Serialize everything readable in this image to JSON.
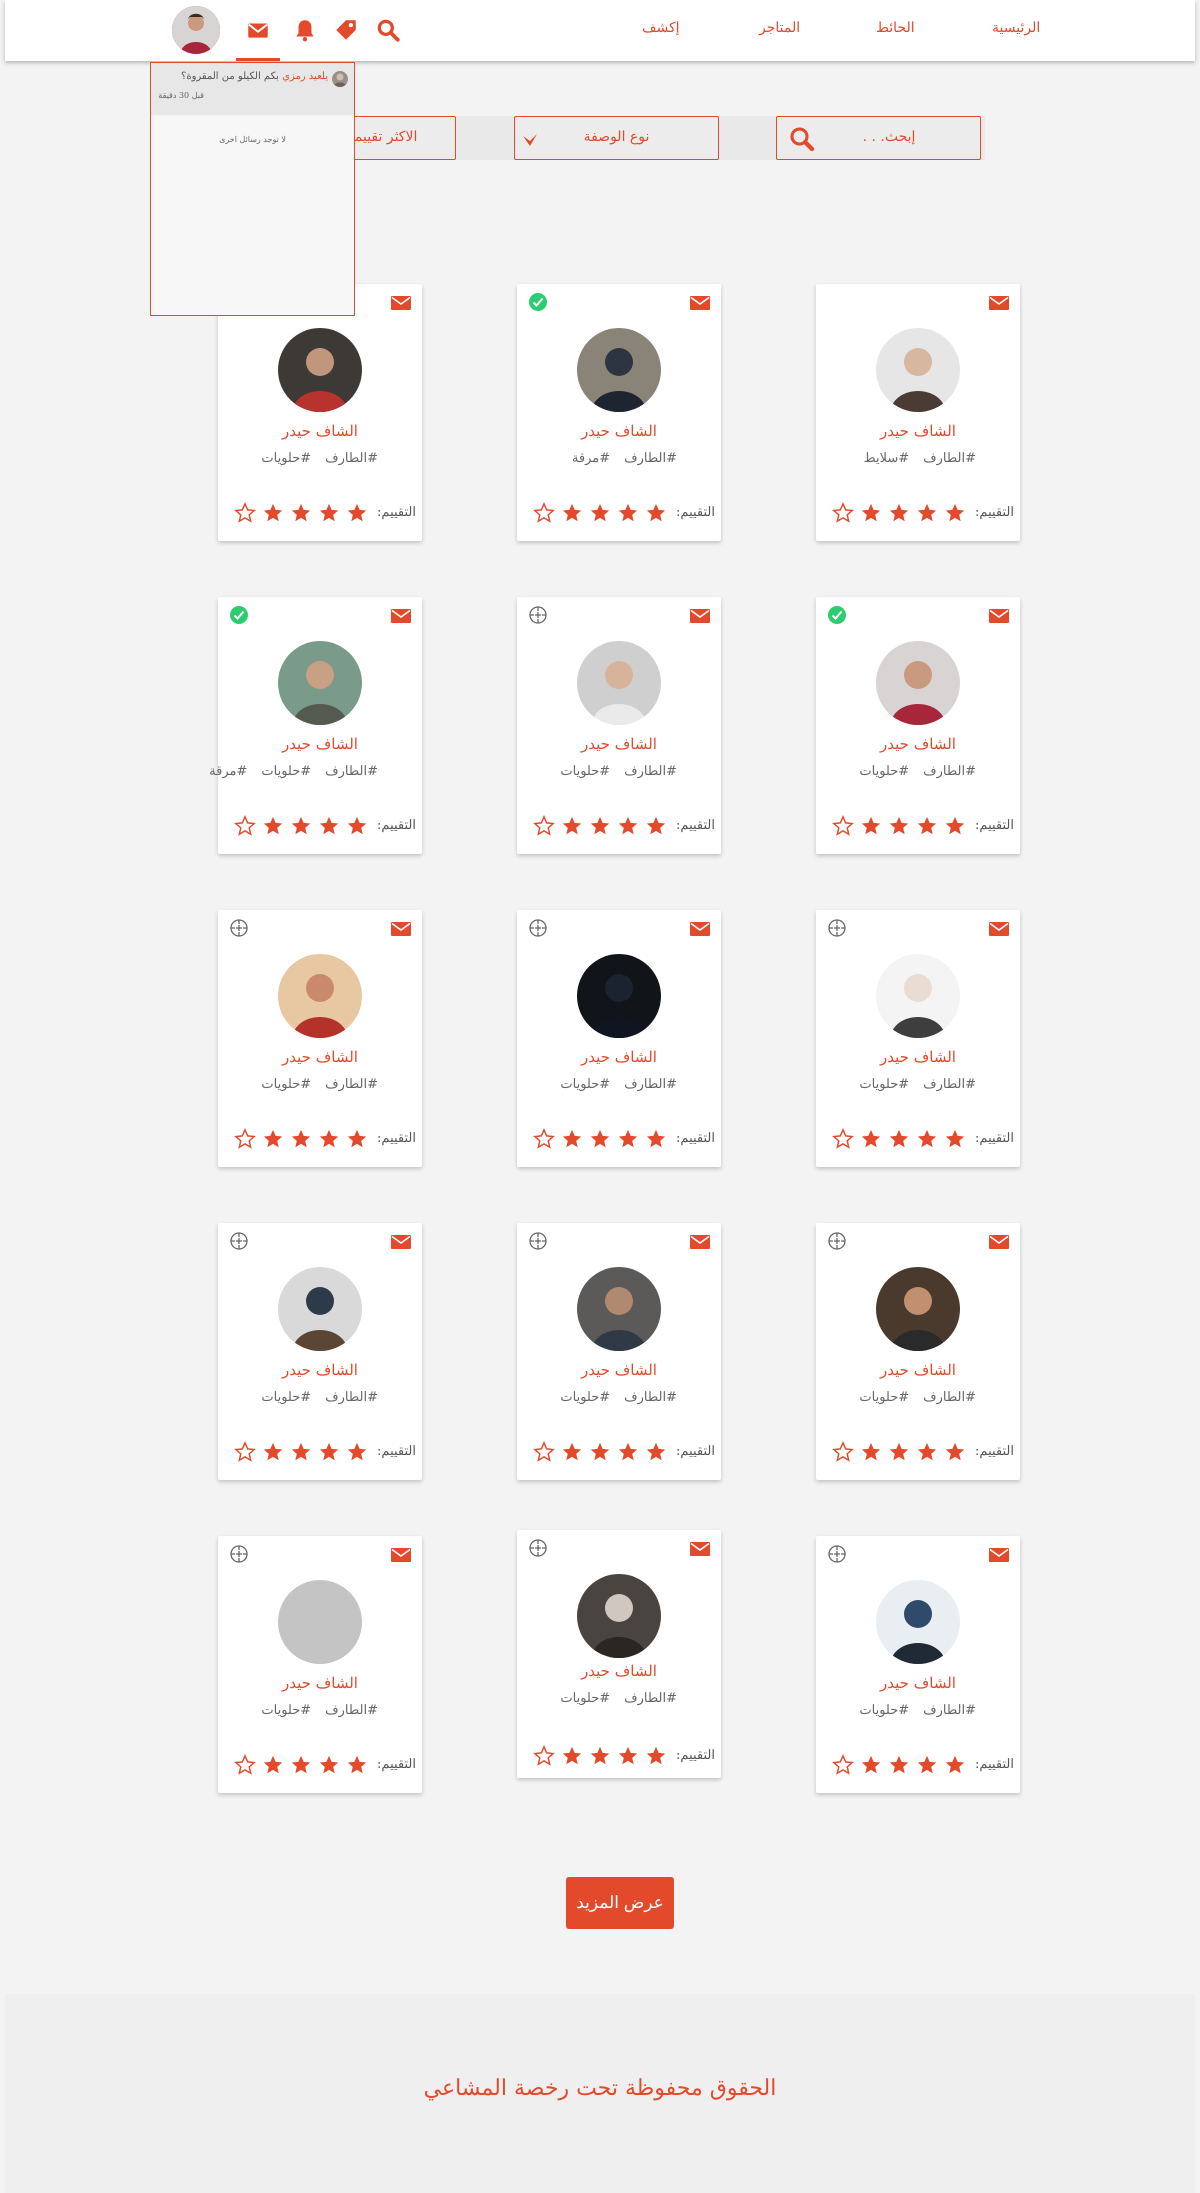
{
  "header": {
    "nav": [
      "الرئيسية",
      "الحائط",
      "المتاجر",
      "إكشف"
    ],
    "icons": [
      "search-icon",
      "tag-icon",
      "bell-icon",
      "mail-icon"
    ]
  },
  "filters": {
    "search_placeholder": "إبحث. . .",
    "recipe_type": "نوع الوصفة",
    "sort": "الاكثر تقييما"
  },
  "notifications": {
    "item_who": "يلعيد رمزي",
    "item_text": "بكم الكيلو من المقروة؟",
    "item_time": "قبل 30 دقيقة",
    "empty_text": "لا توجد رسائل اخرى"
  },
  "cards": [
    {
      "name": "الشاف حيدر",
      "tags": [
        "#الطارف",
        "#سلايط"
      ],
      "rating_label": "التقييم:",
      "rating": 4,
      "status": "none"
    },
    {
      "name": "الشاف حيدر",
      "tags": [
        "#الطارف",
        "#مرقة"
      ],
      "rating_label": "التقييم:",
      "rating": 4,
      "status": "check"
    },
    {
      "name": "الشاف حيدر",
      "tags": [
        "#الطارف",
        "#حلويات"
      ],
      "rating_label": "التقييم:",
      "rating": 4,
      "status": "add"
    },
    {
      "name": "الشاف حيدر",
      "tags": [
        "#الطارف",
        "#حلويات"
      ],
      "rating_label": "التقييم:",
      "rating": 4,
      "status": "check"
    },
    {
      "name": "الشاف حيدر",
      "tags": [
        "#الطارف",
        "#حلويات"
      ],
      "rating_label": "التقييم:",
      "rating": 4,
      "status": "add"
    },
    {
      "name": "الشاف حيدر",
      "tags": [
        "#الطارف",
        "#حلويات",
        "#مرقة"
      ],
      "rating_label": "التقييم:",
      "rating": 4,
      "status": "check"
    },
    {
      "name": "الشاف حيدر",
      "tags": [
        "#الطارف",
        "#حلويات"
      ],
      "rating_label": "التقييم:",
      "rating": 4,
      "status": "add"
    },
    {
      "name": "الشاف حيدر",
      "tags": [
        "#الطارف",
        "#حلويات"
      ],
      "rating_label": "التقييم:",
      "rating": 4,
      "status": "add"
    },
    {
      "name": "الشاف حيدر",
      "tags": [
        "#الطارف",
        "#حلويات"
      ],
      "rating_label": "التقييم:",
      "rating": 4,
      "status": "add"
    },
    {
      "name": "الشاف حيدر",
      "tags": [
        "#الطارف",
        "#حلويات"
      ],
      "rating_label": "التقييم:",
      "rating": 4,
      "status": "add"
    },
    {
      "name": "الشاف حيدر",
      "tags": [
        "#الطارف",
        "#حلويات"
      ],
      "rating_label": "التقييم:",
      "rating": 4,
      "status": "add"
    },
    {
      "name": "الشاف حيدر",
      "tags": [
        "#الطارف",
        "#حلويات"
      ],
      "rating_label": "التقييم:",
      "rating": 4,
      "status": "add"
    },
    {
      "name": "الشاف حيدر",
      "tags": [
        "#الطارف",
        "#حلويات"
      ],
      "rating_label": "التقييم:",
      "rating": 4,
      "status": "add"
    },
    {
      "name": "الشاف حيدر",
      "tags": [
        "#الطارف",
        "#حلويات"
      ],
      "rating_label": "التقييم:",
      "rating": 4,
      "status": "add"
    },
    {
      "name": "الشاف حيدر",
      "tags": [
        "#الطارف",
        "#حلويات"
      ],
      "rating_label": "التقييم:",
      "rating": 4,
      "status": "add"
    }
  ],
  "load_more": "عرض المزيد",
  "footer": "الحقوق محفوظة تحت رخصة المشاعي",
  "colors": {
    "accent": "#e34a2c",
    "check": "#2ecc71"
  }
}
